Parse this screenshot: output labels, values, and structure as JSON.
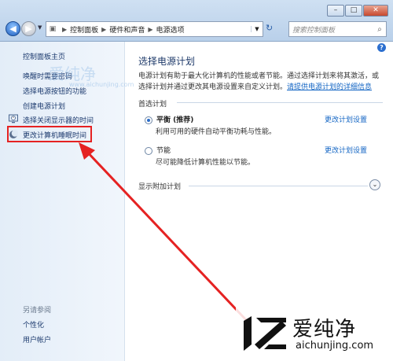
{
  "window": {
    "minimize": "–",
    "maximize": "□",
    "close": "✕"
  },
  "nav": {
    "back_glyph": "◀",
    "forward_glyph": "▶",
    "breadcrumb": [
      "控制面板",
      "硬件和声音",
      "电源选项"
    ],
    "search_placeholder": "搜索控制面板"
  },
  "sidebar": {
    "home": "控制面板主页",
    "items": [
      {
        "label": "唤醒时需要密码",
        "icon": "none"
      },
      {
        "label": "选择电源按钮的功能",
        "icon": "none"
      },
      {
        "label": "创建电源计划",
        "icon": "none"
      },
      {
        "label": "选择关闭显示器的时间",
        "icon": "monitor-clock-icon"
      },
      {
        "label": "更改计算机睡眠时间",
        "icon": "moon-icon"
      }
    ],
    "see_also_title": "另请参阅",
    "see_also": [
      "个性化",
      "用户帐户"
    ]
  },
  "main": {
    "title": "选择电源计划",
    "desc_line1": "电源计划有助于最大化计算机的性能或者节能。通过选择计划来将其激活，或",
    "desc_line2_prefix": "选择计划并通过更改其电源设置来自定义计划。",
    "desc_link": "请提供电源计划的详细信息",
    "preferred_label": "首选计划",
    "plans": [
      {
        "name": "平衡 (推荐)",
        "desc": "利用可用的硬件自动平衡功耗与性能。",
        "selected": true,
        "change": "更改计划设置"
      },
      {
        "name": "节能",
        "desc": "尽可能降低计算机性能以节能。",
        "selected": false,
        "change": "更改计划设置"
      }
    ],
    "more_plans": "显示附加计划"
  },
  "watermark": {
    "brand": "爱纯净",
    "url": "aichunjing.com",
    "faint_url": "www.aichunjing.com"
  },
  "colors": {
    "highlight": "#e52222",
    "link": "#1466c4"
  }
}
